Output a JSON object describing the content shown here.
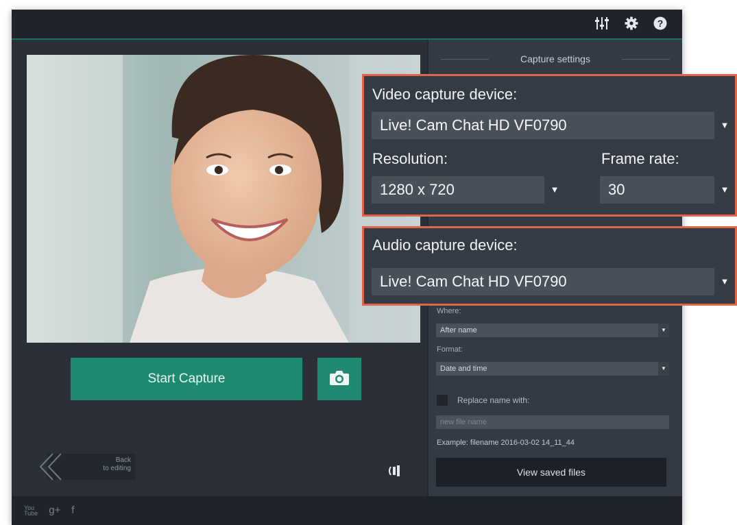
{
  "toolbar": {
    "icons": [
      "mixer-icon",
      "gear-icon",
      "help-icon"
    ]
  },
  "preview": {
    "description_icon": "webcam-preview"
  },
  "capture": {
    "start_label": "Start Capture",
    "snapshot_icon": "camera-icon"
  },
  "back": {
    "line1": "Back",
    "line2": "to editing"
  },
  "settings": {
    "title": "Capture settings",
    "where_label": "Where:",
    "where_value": "After name",
    "format_label": "Format:",
    "format_value": "Date and time",
    "replace_label": "Replace name with:",
    "replace_checked": false,
    "newname_placeholder": "new file name",
    "example": "Example: filename 2016-03-02 14_11_44",
    "view_saved_label": "View saved files"
  },
  "video_box": {
    "device_label": "Video capture device:",
    "device_value": "Live! Cam Chat HD VF0790",
    "resolution_label": "Resolution:",
    "resolution_value": "1280 x 720",
    "framerate_label": "Frame rate:",
    "framerate_value": "30"
  },
  "audio_box": {
    "device_label": "Audio capture device:",
    "device_value": "Live! Cam Chat HD VF0790"
  },
  "social": {
    "youtube_text": "You\nTube",
    "gplus_text": "g+",
    "facebook_text": "f"
  },
  "colors": {
    "accent": "#1e8a71",
    "highlight_border": "#e0654d",
    "panel": "#343a43",
    "background": "#2b3038"
  }
}
